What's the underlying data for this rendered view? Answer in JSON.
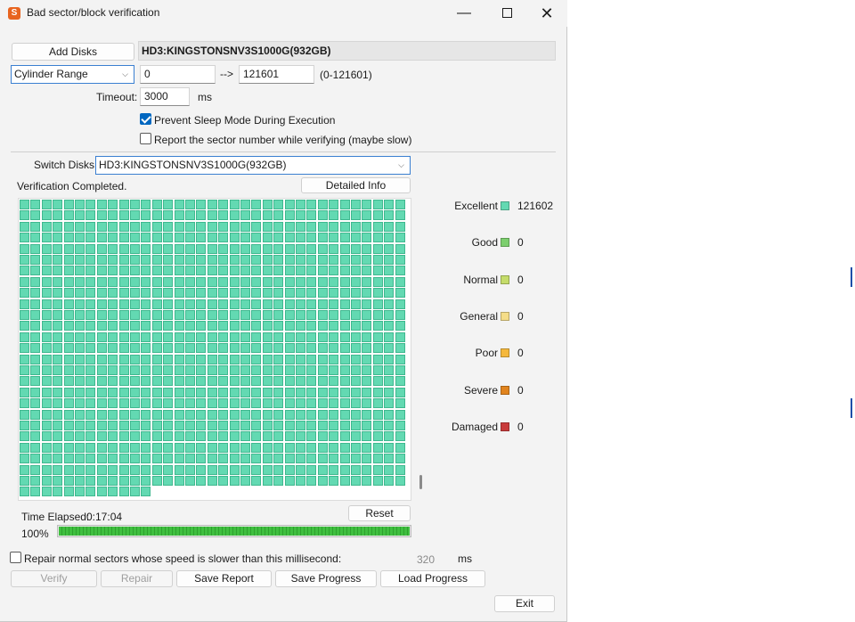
{
  "window": {
    "title": "Bad sector/block verification",
    "icon": "app-logo-icon"
  },
  "controls": {
    "add_disks": "Add Disks",
    "disk_name": "HD3:KINGSTONSNV3S1000G(932GB)",
    "range_mode": "Cylinder Range",
    "range_from": "0",
    "arrow": "-->",
    "range_to": "121601",
    "range_hint": "(0-121601)",
    "timeout_label": "Timeout:",
    "timeout_value": "3000",
    "timeout_unit": "ms",
    "prevent_sleep_label": "Prevent Sleep Mode During Execution",
    "prevent_sleep_checked": true,
    "report_sector_label": "Report the sector number while verifying (maybe slow)",
    "report_sector_checked": false
  },
  "verification": {
    "switch_disks_label": "Switch Disks:",
    "switch_disks_value": "HD3:KINGSTONSNV3S1000G(932GB)",
    "status": "Verification Completed.",
    "detailed_info": "Detailed Info",
    "grid": {
      "columns": 35,
      "rows": 27,
      "last_row_cells": 12,
      "color": "#63d9b2"
    }
  },
  "legend": [
    {
      "label": "Excellent",
      "count": "121602",
      "color": "#63d9b2"
    },
    {
      "label": "Good",
      "count": "0",
      "color": "#7ccf6e"
    },
    {
      "label": "Normal",
      "count": "0",
      "color": "#c5dc6a"
    },
    {
      "label": "General",
      "count": "0",
      "color": "#f5dd88"
    },
    {
      "label": "Poor",
      "count": "0",
      "color": "#f5b83c"
    },
    {
      "label": "Severe",
      "count": "0",
      "color": "#e1841e"
    },
    {
      "label": "Damaged",
      "count": "0",
      "color": "#c83b3b"
    }
  ],
  "progress": {
    "time_label": "Time Elapsed:",
    "time_value": "0:17:04",
    "reset": "Reset",
    "percent_text": "100%",
    "value": 100
  },
  "repair": {
    "label": "Repair normal sectors whose speed is slower than this millisecond:",
    "checked": false,
    "value": "320",
    "unit": "ms"
  },
  "buttons": {
    "verify": "Verify",
    "repair": "Repair",
    "save_report": "Save Report",
    "save_progress": "Save Progress",
    "load_progress": "Load Progress",
    "exit": "Exit"
  }
}
